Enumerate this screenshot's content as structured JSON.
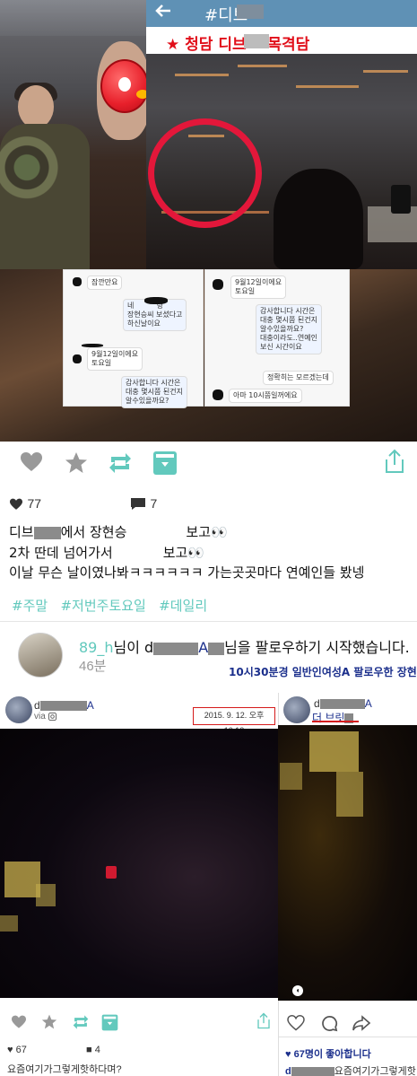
{
  "collage": {
    "insta_hashtag": "#디브",
    "title": "★ 청담 디브** 목격담",
    "chat_left": [
      {
        "text": "잠깐만요"
      },
      {
        "text": "네          랑\n장현승씨 보셨다고\n하신날이요"
      },
      {
        "text": "9월12일이에요\n토요일"
      },
      {
        "text": "감사합니다 시간은\n대충 몇시쯤 된건지\n알수있을까요?"
      }
    ],
    "chat_right": [
      {
        "text": "9월12일이에요\n토요일"
      },
      {
        "text": "감사합니다 시간은\n대충 몇시쯤 된건지\n알수있을까요?\n대충이라도..연예인\n보신 시간이요"
      },
      {
        "text": "정확히는 모르겠는데"
      },
      {
        "text": "아마 10시쯤일꺼에요"
      }
    ]
  },
  "actions": {
    "like_icon": "heart-icon",
    "star_icon": "star-icon",
    "repost_icon": "repost-icon",
    "archive_icon": "archive-icon",
    "share_icon": "share-icon"
  },
  "stats": {
    "likes": "77",
    "comments": "7"
  },
  "caption": {
    "line1_prefix": "디브",
    "line1_mid": "에서 장현승",
    "line1_suffix": "보고👀",
    "line2_prefix": "2차 딴데 넘어가서",
    "line2_suffix": "보고👀",
    "line3": "이날 무슨 날이였나봐ㅋㅋㅋㅋㅋㅋ 가는곳곳마다 연예인들 봤넹"
  },
  "hashtags": [
    "#주말",
    "#저번주토요일",
    "#데일리"
  ],
  "follow": {
    "user_prefix": "89_h",
    "middle": "님이 d",
    "target_suffix": "A",
    "suffix": "님을 팔로우하기 시작했습니다.",
    "time": "46분",
    "note": "10시30분경 일반인여성A 팔로우한 장현승"
  },
  "bottom_left": {
    "user_prefix": "d",
    "user_suffix": "A",
    "via": "via",
    "date_stamp": "2015. 9. 12. 오후 10:13",
    "likes": "67",
    "comments": "4",
    "caption": "요즘여기가그렇게핫하다며?"
  },
  "bottom_right": {
    "user_prefix": "d",
    "user_suffix": "A",
    "location": "더 브릿",
    "likes_text": "67명이 좋아합니다",
    "caption_prefix": "d",
    "caption": "요즘여기가그렇게핫"
  }
}
